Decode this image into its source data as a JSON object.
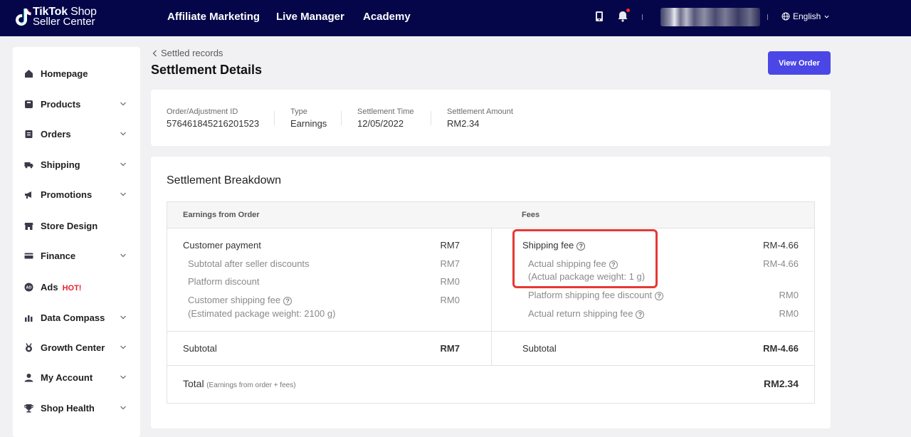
{
  "brand": {
    "line1": "TikTok",
    "line1b": " Shop",
    "line2": "Seller Center"
  },
  "topnav": [
    "Affiliate Marketing",
    "Live Manager",
    "Academy"
  ],
  "language": "English",
  "sidebar": {
    "items": [
      {
        "label": "Homepage",
        "icon": "home-icon",
        "expandable": false
      },
      {
        "label": "Products",
        "icon": "bag-icon",
        "expandable": true
      },
      {
        "label": "Orders",
        "icon": "clipboard-icon",
        "expandable": true
      },
      {
        "label": "Shipping",
        "icon": "truck-icon",
        "expandable": true
      },
      {
        "label": "Promotions",
        "icon": "megaphone-icon",
        "expandable": true
      },
      {
        "label": "Store Design",
        "icon": "store-icon",
        "expandable": false
      },
      {
        "label": "Finance",
        "icon": "card-icon",
        "expandable": true
      },
      {
        "label": "Ads",
        "badge": "HOT!",
        "icon": "ads-icon",
        "expandable": false
      },
      {
        "label": "Data Compass",
        "icon": "chart-icon",
        "expandable": true
      },
      {
        "label": "Growth Center",
        "icon": "medal-icon",
        "expandable": true
      },
      {
        "label": "My Account",
        "icon": "user-icon",
        "expandable": true
      },
      {
        "label": "Shop Health",
        "icon": "trophy-icon",
        "expandable": true
      }
    ]
  },
  "breadcrumb": "Settled records",
  "page_title": "Settlement Details",
  "view_order_label": "View Order",
  "info": [
    {
      "key": "Order/Adjustment ID",
      "value": "576461845216201523"
    },
    {
      "key": "Type",
      "value": "Earnings"
    },
    {
      "key": "Settlement Time",
      "value": "12/05/2022"
    },
    {
      "key": "Settlement Amount",
      "value": "RM2.34"
    }
  ],
  "breakdown": {
    "title": "Settlement Breakdown",
    "earnings_header": "Earnings from Order",
    "fees_header": "Fees",
    "earnings": {
      "customer_payment": {
        "label": "Customer payment",
        "amount": "RM7"
      },
      "subtotal_after_discounts": {
        "label": "Subtotal after seller discounts",
        "amount": "RM7"
      },
      "platform_discount": {
        "label": "Platform discount",
        "amount": "RM0"
      },
      "customer_shipping_fee": {
        "label": "Customer shipping fee",
        "note": "(Estimated package weight: 2100 g)",
        "amount": "RM0"
      }
    },
    "fees": {
      "shipping_fee": {
        "label": "Shipping fee",
        "amount": "RM-4.66"
      },
      "actual_shipping_fee": {
        "label": "Actual shipping fee",
        "note": "(Actual package weight: 1 g)",
        "amount": "RM-4.66"
      },
      "platform_shipping_discount": {
        "label": "Platform shipping fee discount",
        "amount": "RM0"
      },
      "actual_return_shipping": {
        "label": "Actual return shipping fee",
        "amount": "RM0"
      }
    },
    "subtotal_label": "Subtotal",
    "earnings_subtotal": "RM7",
    "fees_subtotal": "RM-4.66",
    "total_label": "Total",
    "total_note": "(Earnings from order + fees)",
    "total_amount": "RM2.34"
  },
  "colors": {
    "topbar": "#05064a",
    "accent": "#4a47e6",
    "highlight": "#e53935",
    "hot": "#e81e2c"
  }
}
